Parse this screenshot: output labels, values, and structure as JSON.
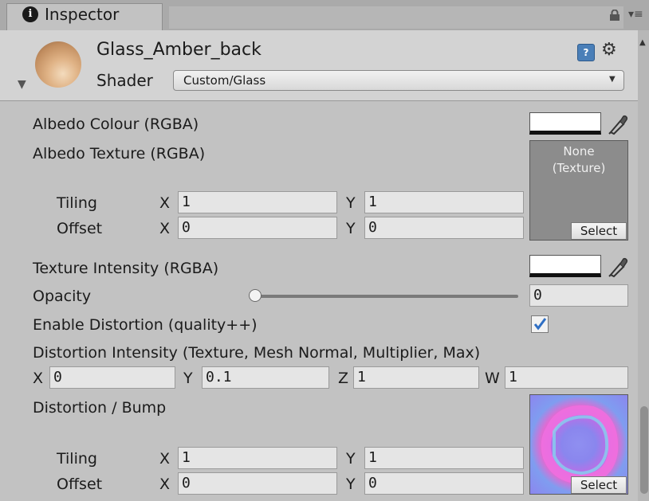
{
  "tab": {
    "icon": "info-icon",
    "label": "Inspector"
  },
  "header": {
    "material_name": "Glass_Amber_back",
    "shader_label": "Shader",
    "shader_value": "Custom/Glass"
  },
  "properties": {
    "albedo_colour": "Albedo Colour (RGBA)",
    "albedo_texture": "Albedo Texture (RGBA)",
    "tiling": "Tiling",
    "offset": "Offset",
    "x": "X",
    "y": "Y",
    "z": "Z",
    "w": "W",
    "albedo_tiling_x": "1",
    "albedo_tiling_y": "1",
    "albedo_offset_x": "0",
    "albedo_offset_y": "0",
    "texture_none": "None",
    "texture_type": "(Texture)",
    "select": "Select",
    "texture_intensity": "Texture Intensity (RGBA)",
    "opacity": "Opacity",
    "opacity_value": "0",
    "opacity_slider_fraction": 0,
    "enable_distortion": "Enable Distortion (quality++)",
    "enable_distortion_checked": true,
    "distortion_intensity": "Distortion Intensity (Texture, Mesh Normal, Multiplier, Max)",
    "dist_x": "0",
    "dist_y": "0.1",
    "dist_z": "1",
    "dist_w": "1",
    "distortion_bump": "Distortion / Bump",
    "bump_tiling_x": "1",
    "bump_tiling_y": "1",
    "bump_offset_x": "0",
    "bump_offset_y": "0"
  },
  "colors": {
    "panel": "#c2c2c2",
    "header": "#d3d3d3",
    "field": "#e5e5e5",
    "checkbox": "#3b82d6"
  }
}
